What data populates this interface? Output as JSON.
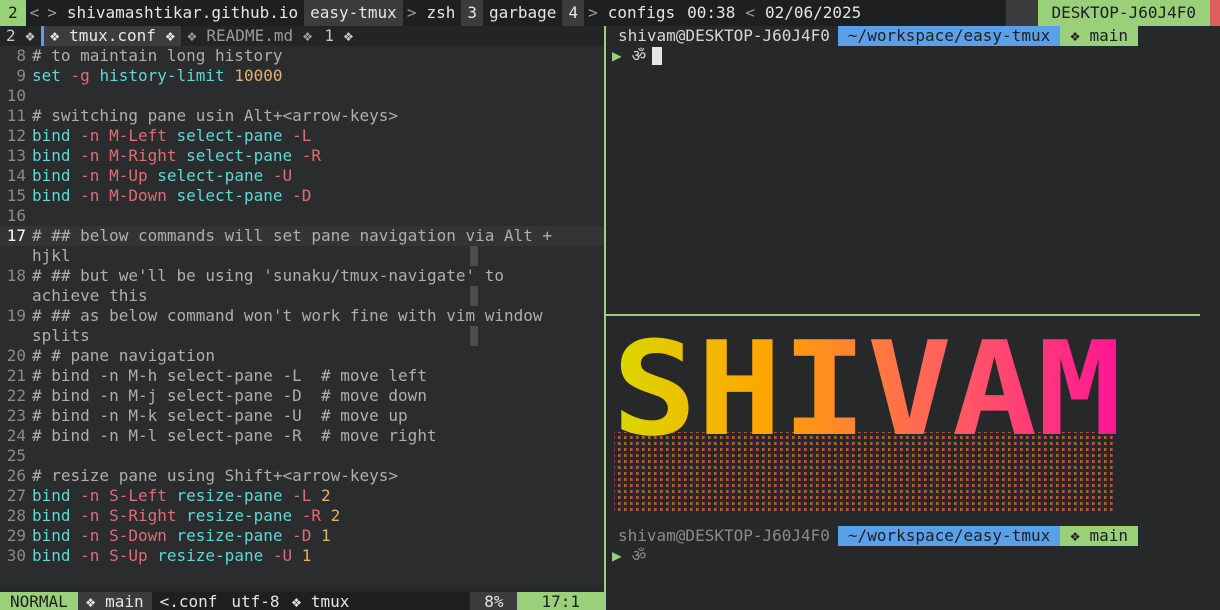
{
  "tmux": {
    "session": "2",
    "nav_left": "<",
    "nav_sep": ">",
    "windows": [
      "shivamashtikar.github.io",
      "easy-tmux",
      "zsh",
      "3",
      "garbage",
      "4",
      "configs"
    ],
    "time": "00:38",
    "date": "02/06/2025",
    "host": "DESKTOP-J60J4F0"
  },
  "editor": {
    "tabs": [
      {
        "label": "2 ❖"
      },
      {
        "label": "❖ tmux.conf ❖"
      },
      {
        "label": "❖ README.md ❖"
      },
      {
        "label": "1 ❖"
      }
    ],
    "lines": [
      {
        "n": "8",
        "parts": [
          {
            "t": "# to maintain long history",
            "c": "cmt"
          }
        ]
      },
      {
        "n": "9",
        "parts": [
          {
            "t": "set",
            "c": "kw"
          },
          {
            "t": " ",
            "c": ""
          },
          {
            "t": "-g",
            "c": "flag"
          },
          {
            "t": " ",
            "c": ""
          },
          {
            "t": "history-limit",
            "c": "kw"
          },
          {
            "t": " ",
            "c": ""
          },
          {
            "t": "10000",
            "c": "num"
          }
        ]
      },
      {
        "n": "10",
        "parts": []
      },
      {
        "n": "11",
        "parts": [
          {
            "t": "# switching pane usin Alt+<arrow-keys>",
            "c": "cmt"
          }
        ]
      },
      {
        "n": "12",
        "parts": [
          {
            "t": "bind",
            "c": "kw"
          },
          {
            "t": " ",
            "c": ""
          },
          {
            "t": "-n",
            "c": "flag"
          },
          {
            "t": " ",
            "c": ""
          },
          {
            "t": "M-Left",
            "c": "flag"
          },
          {
            "t": " ",
            "c": ""
          },
          {
            "t": "select-pane",
            "c": "kw"
          },
          {
            "t": " ",
            "c": ""
          },
          {
            "t": "-L",
            "c": "flag"
          }
        ]
      },
      {
        "n": "13",
        "parts": [
          {
            "t": "bind",
            "c": "kw"
          },
          {
            "t": " ",
            "c": ""
          },
          {
            "t": "-n",
            "c": "flag"
          },
          {
            "t": " ",
            "c": ""
          },
          {
            "t": "M-Right",
            "c": "flag"
          },
          {
            "t": " ",
            "c": ""
          },
          {
            "t": "select-pane",
            "c": "kw"
          },
          {
            "t": " ",
            "c": ""
          },
          {
            "t": "-R",
            "c": "flag"
          }
        ]
      },
      {
        "n": "14",
        "parts": [
          {
            "t": "bind",
            "c": "kw"
          },
          {
            "t": " ",
            "c": ""
          },
          {
            "t": "-n",
            "c": "flag"
          },
          {
            "t": " ",
            "c": ""
          },
          {
            "t": "M-Up",
            "c": "flag"
          },
          {
            "t": " ",
            "c": ""
          },
          {
            "t": "select-pane",
            "c": "kw"
          },
          {
            "t": " ",
            "c": ""
          },
          {
            "t": "-U",
            "c": "flag"
          }
        ]
      },
      {
        "n": "15",
        "parts": [
          {
            "t": "bind",
            "c": "kw"
          },
          {
            "t": " ",
            "c": ""
          },
          {
            "t": "-n",
            "c": "flag"
          },
          {
            "t": " ",
            "c": ""
          },
          {
            "t": "M-Down",
            "c": "flag"
          },
          {
            "t": " ",
            "c": ""
          },
          {
            "t": "select-pane",
            "c": "kw"
          },
          {
            "t": " ",
            "c": ""
          },
          {
            "t": "-D",
            "c": "flag"
          }
        ]
      },
      {
        "n": "16",
        "parts": []
      },
      {
        "n": "17",
        "cur": true,
        "parts": [
          {
            "t": "# ## below commands will set pane navigation via Alt +",
            "c": "cmt"
          }
        ]
      },
      {
        "n": "",
        "parts": [
          {
            "t": "hjkl",
            "c": "cmt"
          }
        ]
      },
      {
        "n": "18",
        "parts": [
          {
            "t": "# ## but we'll be using 'sunaku/tmux-navigate' to",
            "c": "cmt"
          }
        ]
      },
      {
        "n": "",
        "parts": [
          {
            "t": "achieve this",
            "c": "cmt"
          }
        ]
      },
      {
        "n": "19",
        "parts": [
          {
            "t": "# ## as below command won't work fine with vim window",
            "c": "cmt"
          }
        ]
      },
      {
        "n": "",
        "parts": [
          {
            "t": "splits",
            "c": "cmt"
          }
        ]
      },
      {
        "n": "20",
        "parts": [
          {
            "t": "# # pane navigation",
            "c": "cmt"
          }
        ]
      },
      {
        "n": "21",
        "parts": [
          {
            "t": "# bind -n M-h select-pane -L  # move left",
            "c": "cmt"
          }
        ]
      },
      {
        "n": "22",
        "parts": [
          {
            "t": "# bind -n M-j select-pane -D  # move down",
            "c": "cmt"
          }
        ]
      },
      {
        "n": "23",
        "parts": [
          {
            "t": "# bind -n M-k select-pane -U  # move up",
            "c": "cmt"
          }
        ]
      },
      {
        "n": "24",
        "parts": [
          {
            "t": "# bind -n M-l select-pane -R  # move right",
            "c": "cmt"
          }
        ]
      },
      {
        "n": "25",
        "parts": []
      },
      {
        "n": "26",
        "parts": [
          {
            "t": "# resize pane using Shift+<arrow-keys>",
            "c": "cmt"
          }
        ]
      },
      {
        "n": "27",
        "parts": [
          {
            "t": "bind",
            "c": "kw"
          },
          {
            "t": " ",
            "c": ""
          },
          {
            "t": "-n",
            "c": "flag"
          },
          {
            "t": " ",
            "c": ""
          },
          {
            "t": "S-Left",
            "c": "flag"
          },
          {
            "t": " ",
            "c": ""
          },
          {
            "t": "resize-pane",
            "c": "kw"
          },
          {
            "t": " ",
            "c": ""
          },
          {
            "t": "-L",
            "c": "flag"
          },
          {
            "t": " ",
            "c": ""
          },
          {
            "t": "2",
            "c": "num"
          }
        ]
      },
      {
        "n": "28",
        "parts": [
          {
            "t": "bind",
            "c": "kw"
          },
          {
            "t": " ",
            "c": ""
          },
          {
            "t": "-n",
            "c": "flag"
          },
          {
            "t": " ",
            "c": ""
          },
          {
            "t": "S-Right",
            "c": "flag"
          },
          {
            "t": " ",
            "c": ""
          },
          {
            "t": "resize-pane",
            "c": "kw"
          },
          {
            "t": " ",
            "c": ""
          },
          {
            "t": "-R",
            "c": "flag"
          },
          {
            "t": " ",
            "c": ""
          },
          {
            "t": "2",
            "c": "num"
          }
        ]
      },
      {
        "n": "29",
        "parts": [
          {
            "t": "bind",
            "c": "kw"
          },
          {
            "t": " ",
            "c": ""
          },
          {
            "t": "-n",
            "c": "flag"
          },
          {
            "t": " ",
            "c": ""
          },
          {
            "t": "S-Down",
            "c": "flag"
          },
          {
            "t": " ",
            "c": ""
          },
          {
            "t": "resize-pane",
            "c": "kw"
          },
          {
            "t": " ",
            "c": ""
          },
          {
            "t": "-D",
            "c": "flag"
          },
          {
            "t": " ",
            "c": ""
          },
          {
            "t": "1",
            "c": "num"
          }
        ]
      },
      {
        "n": "30",
        "parts": [
          {
            "t": "bind",
            "c": "kw"
          },
          {
            "t": " ",
            "c": ""
          },
          {
            "t": "-n",
            "c": "flag"
          },
          {
            "t": " ",
            "c": ""
          },
          {
            "t": "S-Up",
            "c": "flag"
          },
          {
            "t": " ",
            "c": ""
          },
          {
            "t": "resize-pane",
            "c": "kw"
          },
          {
            "t": " ",
            "c": ""
          },
          {
            "t": "-U",
            "c": "flag"
          },
          {
            "t": " ",
            "c": ""
          },
          {
            "t": "1",
            "c": "num"
          }
        ]
      }
    ],
    "status": {
      "mode": "NORMAL",
      "branch": "❖ main",
      "file": "<.conf",
      "encoding": "utf-8",
      "tmux_label": "❖ tmux",
      "percent": "8%",
      "position": "17:1"
    }
  },
  "terminal": {
    "prompt_user": "shivam@DESKTOP-J60J4F0",
    "prompt_path": "~/workspace/easy-tmux",
    "prompt_branch": "❖ main",
    "prompt_symbol": "ॐ",
    "art_text": "SHIVAM"
  },
  "colors": {
    "accent_green": "#9bd07a",
    "accent_blue": "#5aa0e8",
    "art_gradient": [
      "#d9d900",
      "#ffa500",
      "#ff6060",
      "#ff1493"
    ]
  }
}
